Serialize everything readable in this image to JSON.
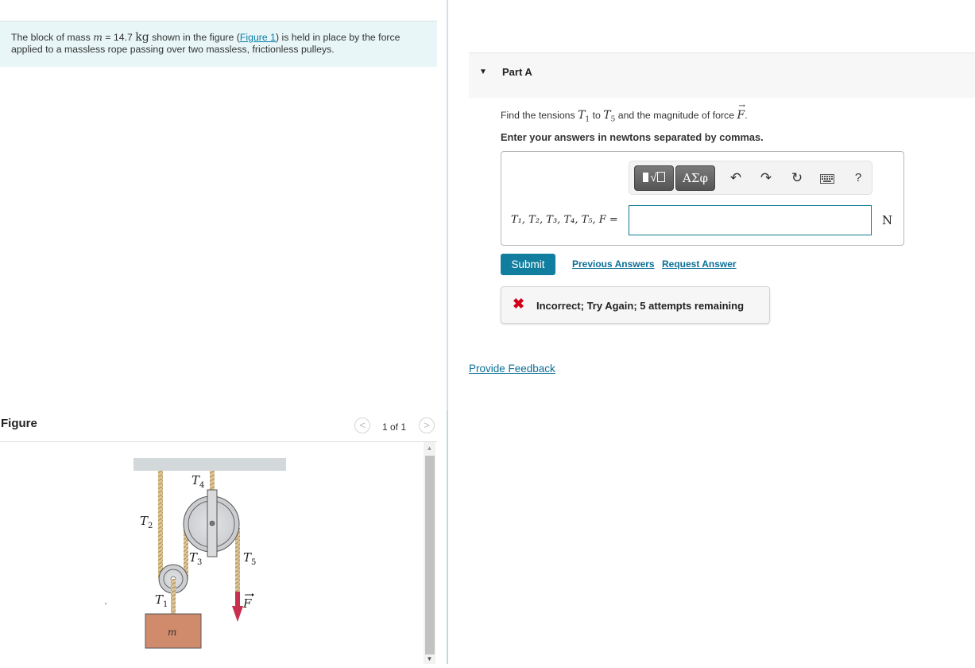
{
  "intro": {
    "text_before": "The block of mass ",
    "mass_symbol": "m",
    "equals_value": " = 14.7 ",
    "mass_unit": "kg",
    "text_middle": " shown in the figure (",
    "figure_link": "Figure 1",
    "text_after": ") is held in place by the force applied to a massless rope passing over two massless, frictionless pulleys."
  },
  "figure": {
    "title": "Figure",
    "page_count": "1 of 1",
    "prev_icon": "chevron-left-icon",
    "next_icon": "chevron-right-icon",
    "labels": {
      "t1": "T",
      "t1_sub": "1",
      "t2": "T",
      "t2_sub": "2",
      "t3": "T",
      "t3_sub": "3",
      "t4": "T",
      "t4_sub": "4",
      "t5": "T",
      "t5_sub": "5",
      "force": "F",
      "mass": "m"
    },
    "colors": {
      "ceiling": "#d2d9db",
      "rope": "#d9bf8c",
      "block": "#d08a6c",
      "pulley": "#d4d6d8",
      "force_arrow": "#c8304f"
    }
  },
  "part": {
    "title": "Part A",
    "question_before": "Find the tensions ",
    "t_first": "T",
    "t_first_sub": "1",
    "question_to": " to ",
    "t_last": "T",
    "t_last_sub": "5",
    "question_after": " and the magnitude of force ",
    "force_symbol": "F",
    "period": ".",
    "instructions": "Enter your answers in newtons separated by commas."
  },
  "toolbar": {
    "templates_icon": "templates-sqrt-icon",
    "symbols_label": "ΑΣφ",
    "undo_icon": "undo-icon",
    "redo_icon": "redo-icon",
    "reset_icon": "reset-icon",
    "keyboard_icon": "keyboard-icon",
    "help_label": "?"
  },
  "answer": {
    "label": "T₁, T₂, T₃, T₄, T₅, F =",
    "value": "",
    "placeholder": "",
    "unit": "N"
  },
  "actions": {
    "submit": "Submit",
    "previous_answers": "Previous Answers",
    "request_answer": "Request Answer"
  },
  "feedback": {
    "icon": "x-icon",
    "text": "Incorrect; Try Again; 5 attempts remaining",
    "color": "#d4001a"
  },
  "provide_feedback": "Provide Feedback"
}
